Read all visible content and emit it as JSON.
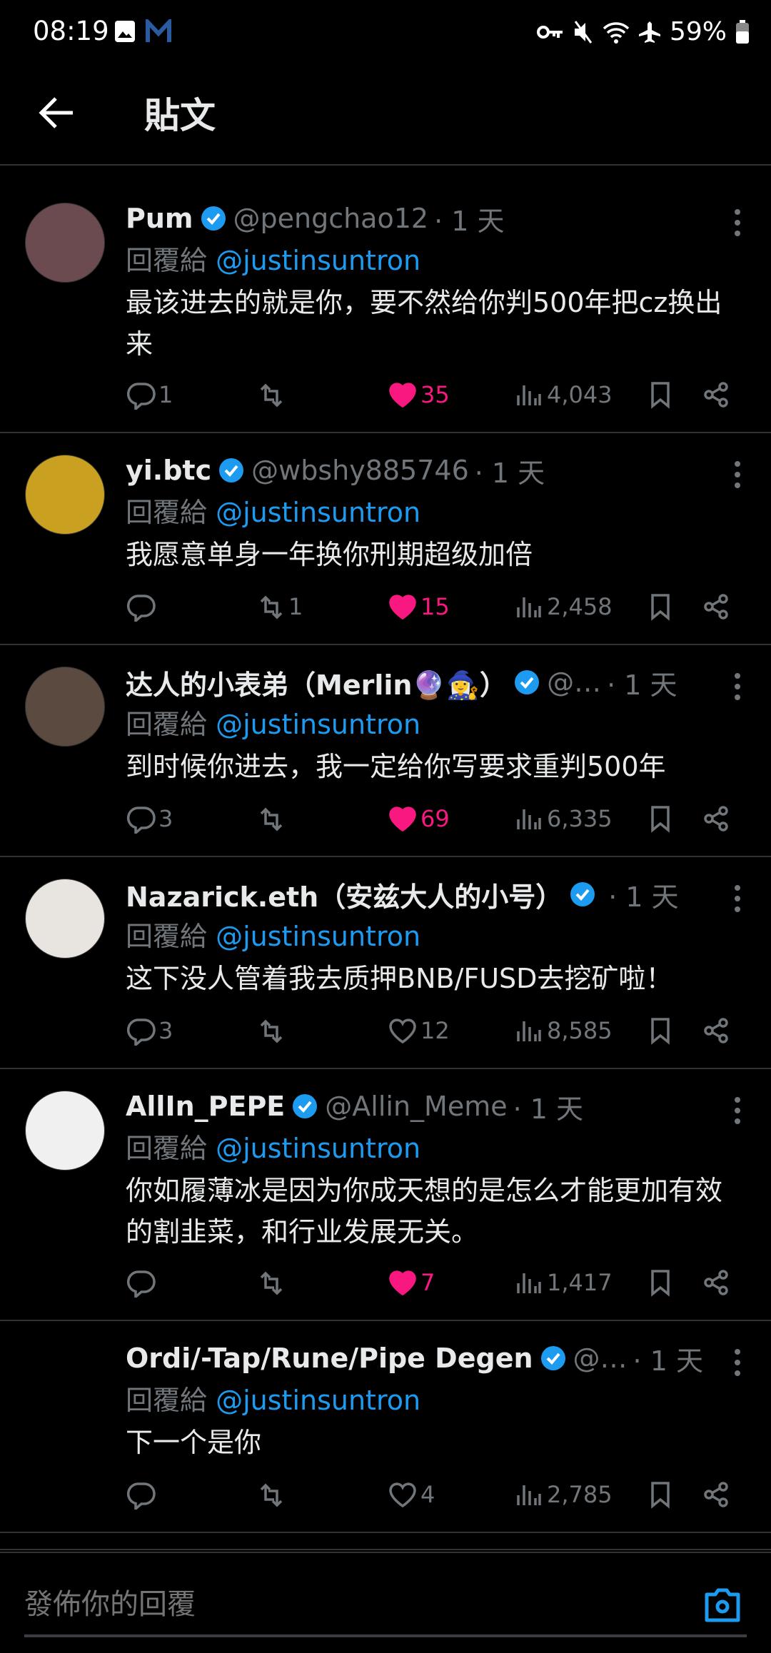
{
  "status_bar": {
    "time": "08:19",
    "battery": "59%"
  },
  "header": {
    "title": "貼文"
  },
  "reply_prefix": "回覆給",
  "posts": [
    {
      "name": "Pum",
      "handle": "@pengchao12",
      "time": "· 1 天",
      "reply_to": "@justinsuntron",
      "text": "最该进去的就是你，要不然给你判500年把cz换出来",
      "replies": "1",
      "reposts": "",
      "likes": "35",
      "liked": true,
      "views": "4,043",
      "avatar_color": "#6b4a50"
    },
    {
      "name": "yi.btc",
      "handle": "@wbshy885746",
      "time": "· 1 天",
      "reply_to": "@justinsuntron",
      "text": "我愿意单身一年换你刑期超级加倍",
      "replies": "",
      "reposts": "1",
      "likes": "15",
      "liked": true,
      "views": "2,458",
      "avatar_color": "#c9a020"
    },
    {
      "name": "达人的小表弟（Merlin🔮🧙‍♀️）",
      "handle": "@…",
      "time": "· 1 天",
      "reply_to": "@justinsuntron",
      "text": "到时候你进去，我一定给你写要求重判500年",
      "replies": "3",
      "reposts": "",
      "likes": "69",
      "liked": true,
      "views": "6,335",
      "avatar_color": "#5a4a40"
    },
    {
      "name": "Nazarick.eth（安兹大人的小号）",
      "handle": "",
      "time": "· 1 天",
      "reply_to": "@justinsuntron",
      "text": "这下没人管着我去质押BNB/FUSD去挖矿啦！",
      "replies": "3",
      "reposts": "",
      "likes": "12",
      "liked": false,
      "views": "8,585",
      "avatar_color": "#e8e4e0"
    },
    {
      "name": "AllIn_PEPE",
      "handle": "@Allin_Meme",
      "time": "· 1 天",
      "reply_to": "@justinsuntron",
      "text": "你如履薄冰是因为你成天想的是怎么才能更加有效的割韭菜，和行业发展无关。",
      "replies": "",
      "reposts": "",
      "likes": "7",
      "liked": true,
      "views": "1,417",
      "avatar_color": "#f0f0f0"
    },
    {
      "name": "Ordi/-Tap/Rune/Pipe Degen",
      "handle": "@…",
      "time": "· 1 天",
      "reply_to": "@justinsuntron",
      "text": "下一个是你",
      "replies": "",
      "reposts": "",
      "likes": "4",
      "liked": false,
      "views": "2,785",
      "avatar_color": "#000000"
    }
  ],
  "reply_bar": {
    "placeholder": "發佈你的回覆"
  },
  "colors": {
    "accent": "#1d9bf0",
    "like": "#f91880",
    "muted": "#71767b"
  }
}
